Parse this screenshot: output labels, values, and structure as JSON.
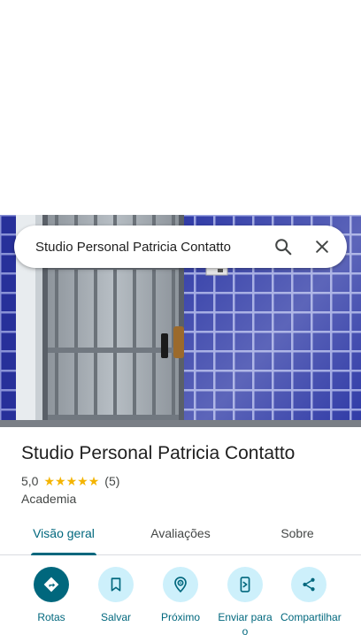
{
  "search": {
    "query": "Studio Personal Patricia Contatto"
  },
  "place": {
    "name": "Studio Personal Patricia Contatto",
    "rating": "5,0",
    "stars": 5,
    "review_count": "(5)",
    "category": "Academia"
  },
  "tabs": [
    {
      "label": "Visão geral",
      "selected": true
    },
    {
      "label": "Avaliações",
      "selected": false
    },
    {
      "label": "Sobre",
      "selected": false
    }
  ],
  "actions": [
    {
      "label": "Rotas",
      "icon": "directions-icon"
    },
    {
      "label": "Salvar",
      "icon": "bookmark-icon"
    },
    {
      "label": "Próximo",
      "icon": "nearby-icon"
    },
    {
      "label": "Enviar para o",
      "icon": "send-to-phone-icon"
    },
    {
      "label": "Compartilhar",
      "icon": "share-icon"
    }
  ],
  "colors": {
    "accent": "#00677d",
    "action_bg": "#cdf0fb",
    "star": "#f4b400",
    "tile_blue": "#2f3aa6"
  }
}
